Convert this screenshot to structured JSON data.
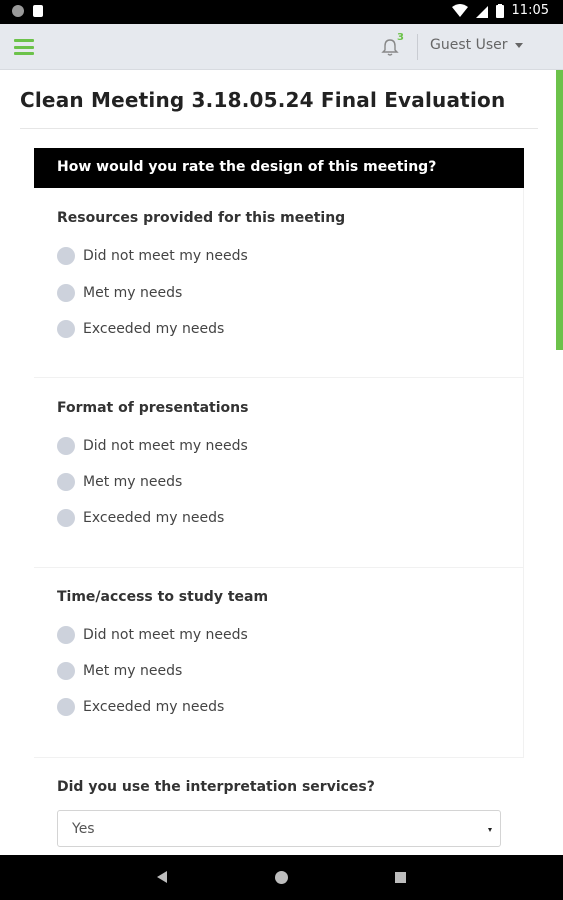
{
  "status_bar": {
    "time": "11:05"
  },
  "header": {
    "notification_count": "3",
    "user_label": "Guest User"
  },
  "page": {
    "title": "Clean Meeting 3.18.05.24 Final Evaluation"
  },
  "section": {
    "heading": "How would you rate the design of this meeting?"
  },
  "questions": [
    {
      "label": "Resources provided for this meeting",
      "options": [
        "Did not meet my needs",
        "Met my needs",
        "Exceeded my needs"
      ]
    },
    {
      "label": "Format of presentations",
      "options": [
        "Did not meet my needs",
        "Met my needs",
        "Exceeded my needs"
      ]
    },
    {
      "label": "Time/access to study team",
      "options": [
        "Did not meet my needs",
        "Met my needs",
        "Exceeded my needs"
      ]
    }
  ],
  "interpretation": {
    "label": "Did you use the interpretation services?",
    "selected": "Yes"
  },
  "colors": {
    "accent": "#6cc24a",
    "header_bg": "#e6e9ee",
    "section_bg": "#000000",
    "radio": "#cdd2dc"
  }
}
